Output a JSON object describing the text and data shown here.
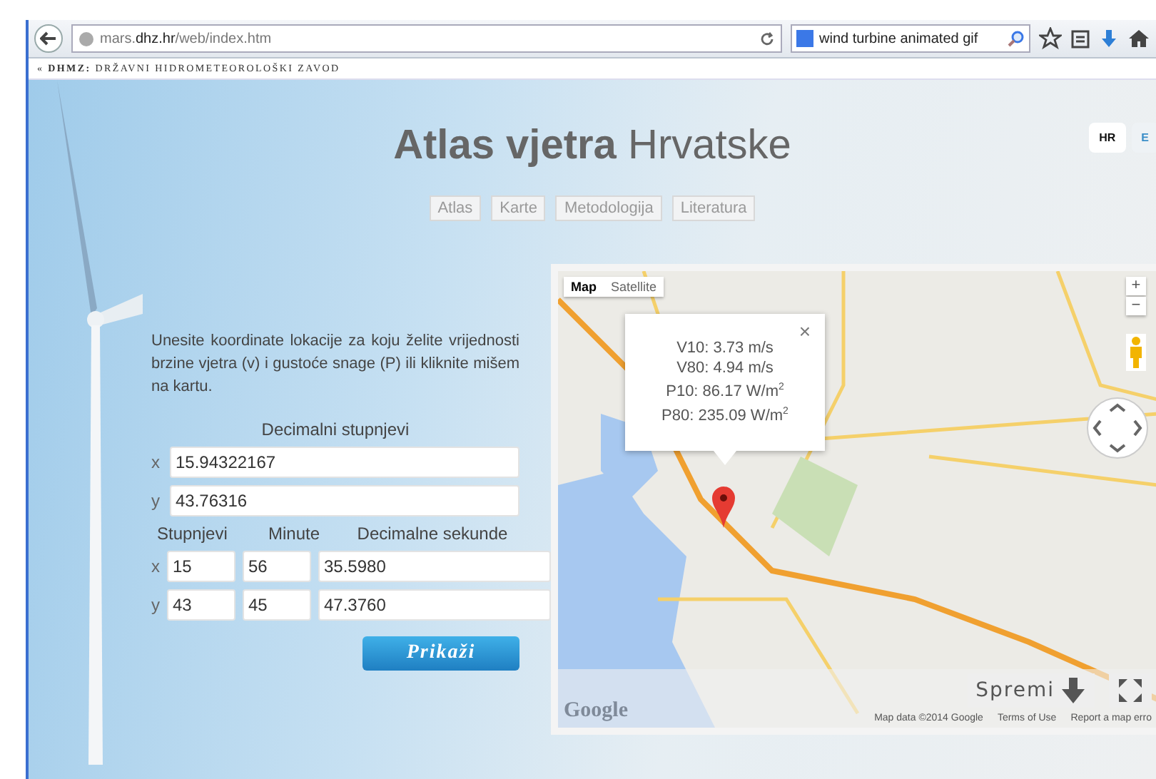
{
  "browser": {
    "url": "mars.**dhz.hr**/web/index.htm",
    "search": "wind turbine animated gif"
  },
  "breadcrumb": "« **DHMZ:** DRŽAVNI HIDROMETEOROLOŠKI ZAVOD",
  "title": "**Atlas vjetra** Hrvatske",
  "nav": [
    {
      "label": "Atlas"
    },
    {
      "label": "Karte"
    },
    {
      "label": "Metodologija"
    },
    {
      "label": "Literatura"
    }
  ],
  "languages": [
    {
      "label": "HR",
      "selected": true
    },
    {
      "label": "E",
      "selected": false
    }
  ],
  "form": {
    "intro": "Unesite koordinate lokacije za koju želite vrijednosti brzine vjetra (v) i gustoće snage (P) ili kliknite mišem na kartu.",
    "decimal_heading": "Decimalni stupnjevi",
    "decimal_rows": [
      {
        "axis": "x",
        "value": "15.94322167"
      },
      {
        "axis": "y",
        "value": "43.76316"
      }
    ],
    "dms_headings": [
      "Stupnjevi",
      "Minute",
      "Decimalne sekunde"
    ],
    "dms_rows": [
      {
        "axis": "x",
        "degrees": "15",
        "minutes": "56",
        "seconds": "35.5980"
      },
      {
        "axis": "y",
        "degrees": "43",
        "minutes": "45",
        "seconds": "47.3760"
      }
    ],
    "submit": "Prikaži"
  },
  "map": {
    "types": [
      {
        "label": "Map",
        "selected": true
      },
      {
        "label": "Satellite",
        "selected": false
      }
    ],
    "zoom_in": "+",
    "zoom_out": "−",
    "info": {
      "close": "×",
      "lines": [
        "V10: 3.73 m/s",
        "V80: 4.94 m/s",
        "P10: 86.17 W/m$^{2}$",
        "P80: 235.09 W/m$^{2}$"
      ]
    },
    "logo": "Google",
    "save": "Spremi",
    "attribution": "Map data ©2014 Google",
    "terms": "Terms of Use",
    "report": "Report a map erro"
  }
}
